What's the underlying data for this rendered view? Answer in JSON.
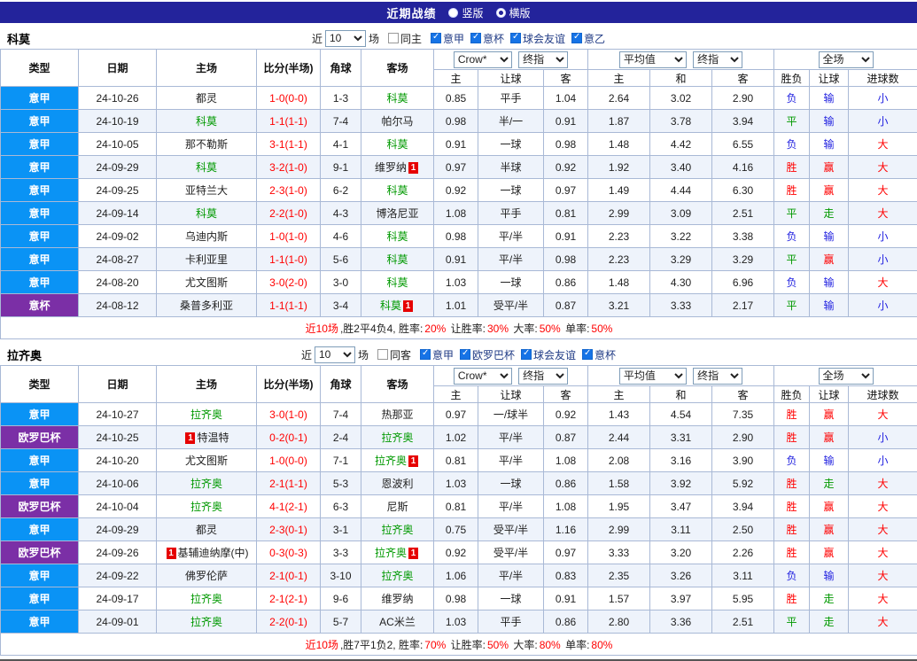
{
  "header": {
    "title": "近期战绩",
    "view_options": [
      {
        "label": "竖版",
        "selected": false
      },
      {
        "label": "横版",
        "selected": true
      }
    ]
  },
  "sections": [
    {
      "team_name": "科莫",
      "filter": {
        "near_label": "近",
        "matches_value": "10",
        "unit_label": "场",
        "same_label": "同主",
        "same_checked": false,
        "leagues": [
          {
            "label": "意甲",
            "checked": true
          },
          {
            "label": "意杯",
            "checked": true
          },
          {
            "label": "球会友谊",
            "checked": true
          },
          {
            "label": "意乙",
            "checked": true
          }
        ]
      },
      "table": {
        "static_headers": [
          "类型",
          "日期",
          "主场",
          "比分(半场)",
          "角球",
          "客场"
        ],
        "group1": {
          "select1": "Crow*",
          "select2": "终指",
          "cols": [
            "主",
            "让球",
            "客"
          ]
        },
        "group2": {
          "select1": "平均值",
          "select2": "终指",
          "cols": [
            "主",
            "和",
            "客"
          ]
        },
        "group3": {
          "select1": "全场",
          "cols": [
            "胜负",
            "让球",
            "进球数"
          ]
        },
        "rows": [
          {
            "type": "意甲",
            "type_kind": "blue",
            "date": "24-10-26",
            "home": "都灵",
            "home_subject": false,
            "home_badge": "",
            "score": "1-0(0-0)",
            "corner": "1-3",
            "away": "科莫",
            "away_subject": true,
            "away_badge": "",
            "o1_home": "0.85",
            "o1_line": "平手",
            "o1_away": "1.04",
            "o2_home": "2.64",
            "o2_draw": "3.02",
            "o2_away": "2.90",
            "r_wdl": "负",
            "r_let": "输",
            "r_goal": "小"
          },
          {
            "type": "意甲",
            "type_kind": "blue",
            "date": "24-10-19",
            "home": "科莫",
            "home_subject": true,
            "home_badge": "",
            "score": "1-1(1-1)",
            "corner": "7-4",
            "away": "帕尔马",
            "away_subject": false,
            "away_badge": "",
            "o1_home": "0.98",
            "o1_line": "半/一",
            "o1_away": "0.91",
            "o2_home": "1.87",
            "o2_draw": "3.78",
            "o2_away": "3.94",
            "r_wdl": "平",
            "r_let": "输",
            "r_goal": "小"
          },
          {
            "type": "意甲",
            "type_kind": "blue",
            "date": "24-10-05",
            "home": "那不勒斯",
            "home_subject": false,
            "home_badge": "",
            "score": "3-1(1-1)",
            "corner": "4-1",
            "away": "科莫",
            "away_subject": true,
            "away_badge": "",
            "o1_home": "0.91",
            "o1_line": "一球",
            "o1_away": "0.98",
            "o2_home": "1.48",
            "o2_draw": "4.42",
            "o2_away": "6.55",
            "r_wdl": "负",
            "r_let": "输",
            "r_goal": "大"
          },
          {
            "type": "意甲",
            "type_kind": "blue",
            "date": "24-09-29",
            "home": "科莫",
            "home_subject": true,
            "home_badge": "",
            "score": "3-2(1-0)",
            "corner": "9-1",
            "away": "维罗纳",
            "away_subject": false,
            "away_badge": "after",
            "o1_home": "0.97",
            "o1_line": "半球",
            "o1_away": "0.92",
            "o2_home": "1.92",
            "o2_draw": "3.40",
            "o2_away": "4.16",
            "r_wdl": "胜",
            "r_let": "赢",
            "r_goal": "大"
          },
          {
            "type": "意甲",
            "type_kind": "blue",
            "date": "24-09-25",
            "home": "亚特兰大",
            "home_subject": false,
            "home_badge": "",
            "score": "2-3(1-0)",
            "corner": "6-2",
            "away": "科莫",
            "away_subject": true,
            "away_badge": "",
            "o1_home": "0.92",
            "o1_line": "一球",
            "o1_away": "0.97",
            "o2_home": "1.49",
            "o2_draw": "4.44",
            "o2_away": "6.30",
            "r_wdl": "胜",
            "r_let": "赢",
            "r_goal": "大"
          },
          {
            "type": "意甲",
            "type_kind": "blue",
            "date": "24-09-14",
            "home": "科莫",
            "home_subject": true,
            "home_badge": "",
            "score": "2-2(1-0)",
            "corner": "4-3",
            "away": "博洛尼亚",
            "away_subject": false,
            "away_badge": "",
            "o1_home": "1.08",
            "o1_line": "平手",
            "o1_away": "0.81",
            "o2_home": "2.99",
            "o2_draw": "3.09",
            "o2_away": "2.51",
            "r_wdl": "平",
            "r_let": "走",
            "r_goal": "大"
          },
          {
            "type": "意甲",
            "type_kind": "blue",
            "date": "24-09-02",
            "home": "乌迪内斯",
            "home_subject": false,
            "home_badge": "",
            "score": "1-0(1-0)",
            "corner": "4-6",
            "away": "科莫",
            "away_subject": true,
            "away_badge": "",
            "o1_home": "0.98",
            "o1_line": "平/半",
            "o1_away": "0.91",
            "o2_home": "2.23",
            "o2_draw": "3.22",
            "o2_away": "3.38",
            "r_wdl": "负",
            "r_let": "输",
            "r_goal": "小"
          },
          {
            "type": "意甲",
            "type_kind": "blue",
            "date": "24-08-27",
            "home": "卡利亚里",
            "home_subject": false,
            "home_badge": "",
            "score": "1-1(1-0)",
            "corner": "5-6",
            "away": "科莫",
            "away_subject": true,
            "away_badge": "",
            "o1_home": "0.91",
            "o1_line": "平/半",
            "o1_away": "0.98",
            "o2_home": "2.23",
            "o2_draw": "3.29",
            "o2_away": "3.29",
            "r_wdl": "平",
            "r_let": "赢",
            "r_goal": "小"
          },
          {
            "type": "意甲",
            "type_kind": "blue",
            "date": "24-08-20",
            "home": "尤文图斯",
            "home_subject": false,
            "home_badge": "",
            "score": "3-0(2-0)",
            "corner": "3-0",
            "away": "科莫",
            "away_subject": true,
            "away_badge": "",
            "o1_home": "1.03",
            "o1_line": "一球",
            "o1_away": "0.86",
            "o2_home": "1.48",
            "o2_draw": "4.30",
            "o2_away": "6.96",
            "r_wdl": "负",
            "r_let": "输",
            "r_goal": "大"
          },
          {
            "type": "意杯",
            "type_kind": "purple",
            "date": "24-08-12",
            "home": "桑普多利亚",
            "home_subject": false,
            "home_badge": "",
            "score": "1-1(1-1)",
            "corner": "3-4",
            "away": "科莫",
            "away_subject": true,
            "away_badge": "after",
            "o1_home": "1.01",
            "o1_line": "受平/半",
            "o1_away": "0.87",
            "o2_home": "3.21",
            "o2_draw": "3.33",
            "o2_away": "2.17",
            "r_wdl": "平",
            "r_let": "输",
            "r_goal": "小"
          }
        ]
      },
      "summary": [
        {
          "t": "近10场",
          "c": "red"
        },
        {
          "t": ",胜2平4负4, 胜率:",
          "c": "black"
        },
        {
          "t": "20%",
          "c": "red"
        },
        {
          "t": " 让胜率:",
          "c": "black"
        },
        {
          "t": "30%",
          "c": "red"
        },
        {
          "t": " 大率:",
          "c": "black"
        },
        {
          "t": "50%",
          "c": "red"
        },
        {
          "t": " 单率:",
          "c": "black"
        },
        {
          "t": "50%",
          "c": "red"
        }
      ]
    },
    {
      "team_name": "拉齐奥",
      "filter": {
        "near_label": "近",
        "matches_value": "10",
        "unit_label": "场",
        "same_label": "同客",
        "same_checked": false,
        "leagues": [
          {
            "label": "意甲",
            "checked": true
          },
          {
            "label": "欧罗巴杯",
            "checked": true
          },
          {
            "label": "球会友谊",
            "checked": true
          },
          {
            "label": "意杯",
            "checked": true
          }
        ]
      },
      "table": {
        "static_headers": [
          "类型",
          "日期",
          "主场",
          "比分(半场)",
          "角球",
          "客场"
        ],
        "group1": {
          "select1": "Crow*",
          "select2": "终指",
          "cols": [
            "主",
            "让球",
            "客"
          ]
        },
        "group2": {
          "select1": "平均值",
          "select2": "终指",
          "cols": [
            "主",
            "和",
            "客"
          ]
        },
        "group3": {
          "select1": "全场",
          "cols": [
            "胜负",
            "让球",
            "进球数"
          ]
        },
        "rows": [
          {
            "type": "意甲",
            "type_kind": "blue",
            "date": "24-10-27",
            "home": "拉齐奥",
            "home_subject": true,
            "home_badge": "",
            "score": "3-0(1-0)",
            "corner": "7-4",
            "away": "热那亚",
            "away_subject": false,
            "away_badge": "",
            "o1_home": "0.97",
            "o1_line": "一/球半",
            "o1_away": "0.92",
            "o2_home": "1.43",
            "o2_draw": "4.54",
            "o2_away": "7.35",
            "r_wdl": "胜",
            "r_let": "赢",
            "r_goal": "大"
          },
          {
            "type": "欧罗巴杯",
            "type_kind": "purple",
            "date": "24-10-25",
            "home": "特温特",
            "home_subject": false,
            "home_badge": "before",
            "score": "0-2(0-1)",
            "corner": "2-4",
            "away": "拉齐奥",
            "away_subject": true,
            "away_badge": "",
            "o1_home": "1.02",
            "o1_line": "平/半",
            "o1_away": "0.87",
            "o2_home": "2.44",
            "o2_draw": "3.31",
            "o2_away": "2.90",
            "r_wdl": "胜",
            "r_let": "赢",
            "r_goal": "小"
          },
          {
            "type": "意甲",
            "type_kind": "blue",
            "date": "24-10-20",
            "home": "尤文图斯",
            "home_subject": false,
            "home_badge": "",
            "score": "1-0(0-0)",
            "corner": "7-1",
            "away": "拉齐奥",
            "away_subject": true,
            "away_badge": "after",
            "o1_home": "0.81",
            "o1_line": "平/半",
            "o1_away": "1.08",
            "o2_home": "2.08",
            "o2_draw": "3.16",
            "o2_away": "3.90",
            "r_wdl": "负",
            "r_let": "输",
            "r_goal": "小"
          },
          {
            "type": "意甲",
            "type_kind": "blue",
            "date": "24-10-06",
            "home": "拉齐奥",
            "home_subject": true,
            "home_badge": "",
            "score": "2-1(1-1)",
            "corner": "5-3",
            "away": "恩波利",
            "away_subject": false,
            "away_badge": "",
            "o1_home": "1.03",
            "o1_line": "一球",
            "o1_away": "0.86",
            "o2_home": "1.58",
            "o2_draw": "3.92",
            "o2_away": "5.92",
            "r_wdl": "胜",
            "r_let": "走",
            "r_goal": "大"
          },
          {
            "type": "欧罗巴杯",
            "type_kind": "purple",
            "date": "24-10-04",
            "home": "拉齐奥",
            "home_subject": true,
            "home_badge": "",
            "score": "4-1(2-1)",
            "corner": "6-3",
            "away": "尼斯",
            "away_subject": false,
            "away_badge": "",
            "o1_home": "0.81",
            "o1_line": "平/半",
            "o1_away": "1.08",
            "o2_home": "1.95",
            "o2_draw": "3.47",
            "o2_away": "3.94",
            "r_wdl": "胜",
            "r_let": "赢",
            "r_goal": "大"
          },
          {
            "type": "意甲",
            "type_kind": "blue",
            "date": "24-09-29",
            "home": "都灵",
            "home_subject": false,
            "home_badge": "",
            "score": "2-3(0-1)",
            "corner": "3-1",
            "away": "拉齐奥",
            "away_subject": true,
            "away_badge": "",
            "o1_home": "0.75",
            "o1_line": "受平/半",
            "o1_away": "1.16",
            "o2_home": "2.99",
            "o2_draw": "3.11",
            "o2_away": "2.50",
            "r_wdl": "胜",
            "r_let": "赢",
            "r_goal": "大"
          },
          {
            "type": "欧罗巴杯",
            "type_kind": "purple",
            "date": "24-09-26",
            "home": "基辅迪纳摩(中)",
            "home_subject": false,
            "home_badge": "before",
            "score": "0-3(0-3)",
            "corner": "3-3",
            "away": "拉齐奥",
            "away_subject": true,
            "away_badge": "after",
            "o1_home": "0.92",
            "o1_line": "受平/半",
            "o1_away": "0.97",
            "o2_home": "3.33",
            "o2_draw": "3.20",
            "o2_away": "2.26",
            "r_wdl": "胜",
            "r_let": "赢",
            "r_goal": "大"
          },
          {
            "type": "意甲",
            "type_kind": "blue",
            "date": "24-09-22",
            "home": "佛罗伦萨",
            "home_subject": false,
            "home_badge": "",
            "score": "2-1(0-1)",
            "corner": "3-10",
            "away": "拉齐奥",
            "away_subject": true,
            "away_badge": "",
            "o1_home": "1.06",
            "o1_line": "平/半",
            "o1_away": "0.83",
            "o2_home": "2.35",
            "o2_draw": "3.26",
            "o2_away": "3.11",
            "r_wdl": "负",
            "r_let": "输",
            "r_goal": "大"
          },
          {
            "type": "意甲",
            "type_kind": "blue",
            "date": "24-09-17",
            "home": "拉齐奥",
            "home_subject": true,
            "home_badge": "",
            "score": "2-1(2-1)",
            "corner": "9-6",
            "away": "维罗纳",
            "away_subject": false,
            "away_badge": "",
            "o1_home": "0.98",
            "o1_line": "一球",
            "o1_away": "0.91",
            "o2_home": "1.57",
            "o2_draw": "3.97",
            "o2_away": "5.95",
            "r_wdl": "胜",
            "r_let": "走",
            "r_goal": "大"
          },
          {
            "type": "意甲",
            "type_kind": "blue",
            "date": "24-09-01",
            "home": "拉齐奥",
            "home_subject": true,
            "home_badge": "",
            "score": "2-2(0-1)",
            "corner": "5-7",
            "away": "AC米兰",
            "away_subject": false,
            "away_badge": "",
            "o1_home": "1.03",
            "o1_line": "平手",
            "o1_away": "0.86",
            "o2_home": "2.80",
            "o2_draw": "3.36",
            "o2_away": "2.51",
            "r_wdl": "平",
            "r_let": "走",
            "r_goal": "大"
          }
        ]
      },
      "summary": [
        {
          "t": "近10场",
          "c": "red"
        },
        {
          "t": ",胜7平1负2, 胜率:",
          "c": "black"
        },
        {
          "t": "70%",
          "c": "red"
        },
        {
          "t": " 让胜率:",
          "c": "black"
        },
        {
          "t": "50%",
          "c": "red"
        },
        {
          "t": " 大率:",
          "c": "black"
        },
        {
          "t": "80%",
          "c": "red"
        },
        {
          "t": " 单率:",
          "c": "black"
        },
        {
          "t": "80%",
          "c": "red"
        }
      ]
    }
  ]
}
